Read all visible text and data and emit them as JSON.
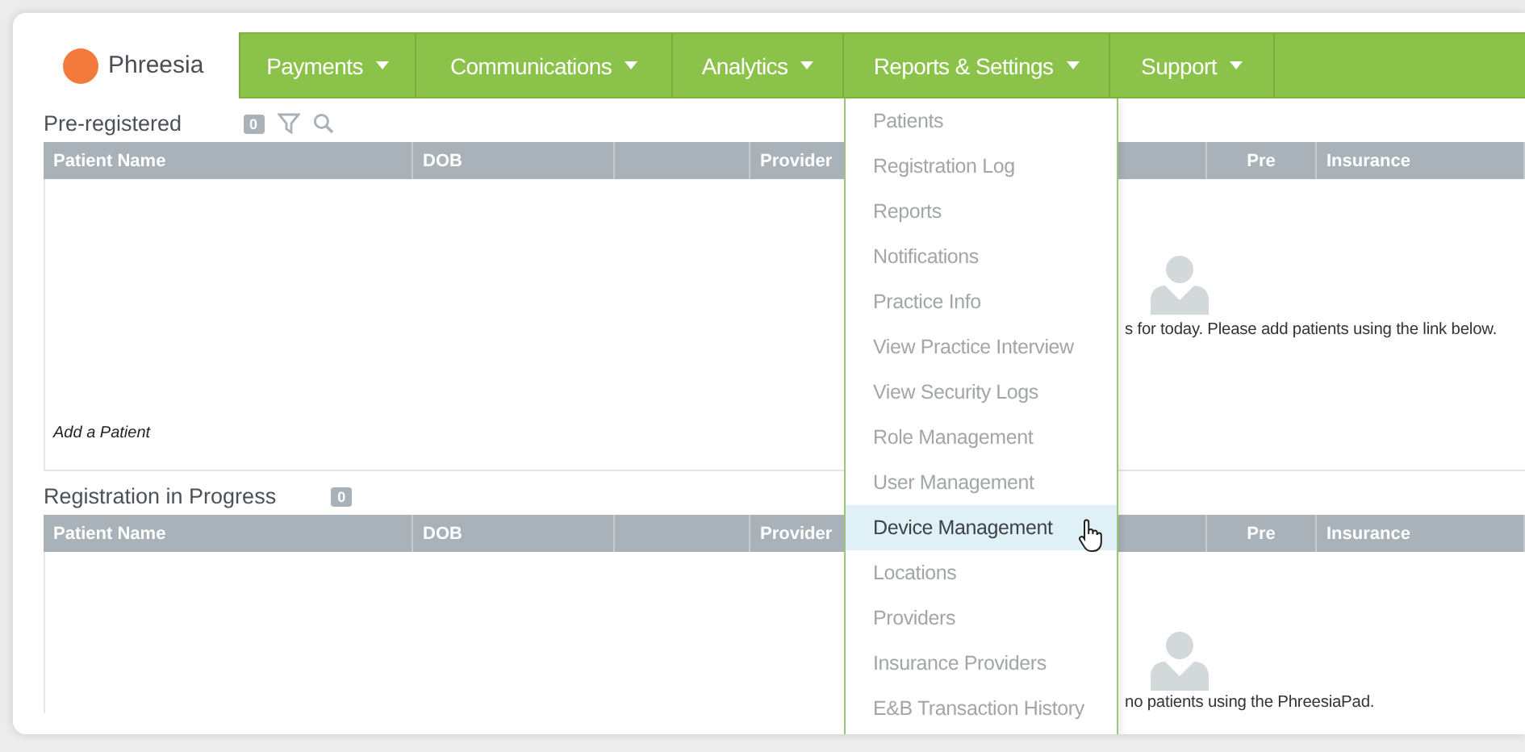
{
  "logo": {
    "name": "Phreesia"
  },
  "nav": [
    {
      "label": "Payments"
    },
    {
      "label": "Communications"
    },
    {
      "label": "Analytics"
    },
    {
      "label": "Reports & Settings",
      "menu": [
        {
          "label": "Patients",
          "selected": false
        },
        {
          "label": "Registration Log",
          "selected": false
        },
        {
          "label": "Reports",
          "selected": false
        },
        {
          "label": "Notifications",
          "selected": false
        },
        {
          "label": "Practice Info",
          "selected": false
        },
        {
          "label": "View Practice Interview",
          "selected": false
        },
        {
          "label": "View Security Logs",
          "selected": false
        },
        {
          "label": "Role Management",
          "selected": false
        },
        {
          "label": "User Management",
          "selected": false
        },
        {
          "label": "Device Management",
          "selected": true
        },
        {
          "label": "Locations",
          "selected": false
        },
        {
          "label": "Providers",
          "selected": false
        },
        {
          "label": "Insurance Providers",
          "selected": false
        },
        {
          "label": "E&B Transaction History",
          "selected": false
        }
      ]
    },
    {
      "label": "Support"
    }
  ],
  "sections": [
    {
      "title": "Pre-registered",
      "count": "0",
      "tools": [
        {
          "kind": "filter"
        },
        {
          "kind": "search"
        }
      ],
      "columns": [
        {
          "label": "Patient Name"
        },
        {
          "label": "DOB"
        },
        {},
        {
          "label": "Provider"
        },
        {},
        {
          "label": "Pre"
        },
        {
          "label": "Insurance"
        }
      ],
      "empty_message": "s for today. Please add patients using the link below.",
      "add_link": "Add a Patient"
    },
    {
      "title": "Registration in Progress",
      "count": "0",
      "columns": [
        {
          "label": "Patient Name"
        },
        {
          "label": "DOB"
        },
        {},
        {
          "label": "Provider"
        },
        {},
        {
          "label": "Pre"
        },
        {
          "label": "Insurance"
        }
      ],
      "empty_message": "no patients using the PhreesiaPad."
    }
  ]
}
